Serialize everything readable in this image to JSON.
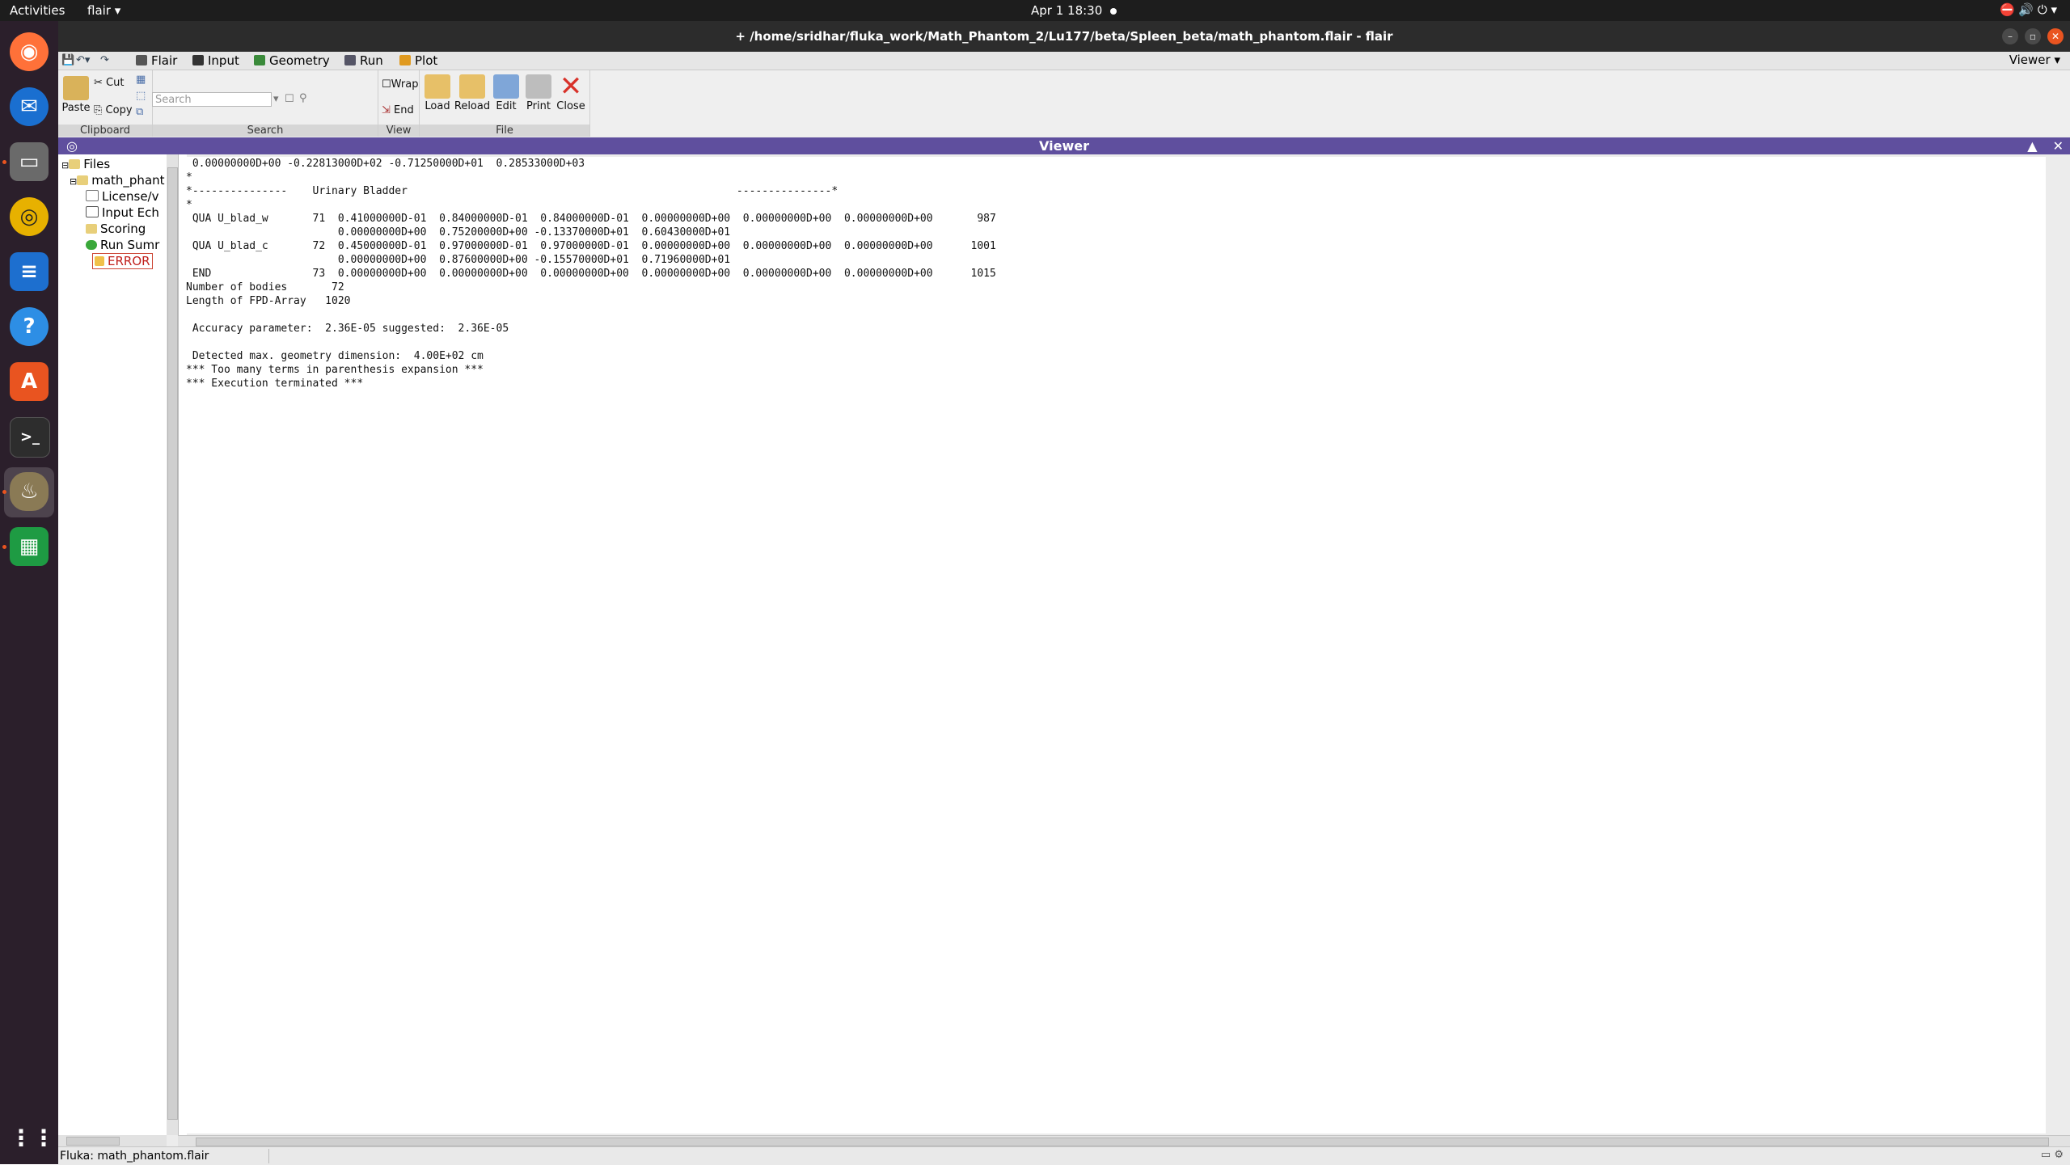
{
  "system_bar": {
    "activities": "Activities",
    "app_menu": "flair ▾",
    "clock": "Apr 1  18:30",
    "tray": "⛔   🔊  ⏻  ▾"
  },
  "window": {
    "title": "+ /home/sridhar/fluka_work/Math_Phantom_2/Lu177/beta/Spleen_beta/math_phantom.flair - flair",
    "minimize": "–",
    "maximize": "▫",
    "close": "✕"
  },
  "dock": {
    "items": [
      "Firefox",
      "Thunderbird",
      "Files",
      "Rhythmbox",
      "LibreOffice Writer",
      "Help",
      "Ubuntu Software",
      "Terminal",
      "flair",
      "LibreOffice Calc",
      "Show Applications"
    ]
  },
  "menu": {
    "tabs": [
      "Flair",
      "Input",
      "Geometry",
      "Run",
      "Plot"
    ],
    "viewer_selector": "Viewer ▾"
  },
  "ribbon": {
    "clipboard": {
      "paste": "Paste",
      "cut": "Cut",
      "copy": "Copy",
      "label": "Clipboard"
    },
    "search": {
      "placeholder": "Search",
      "label": "Search"
    },
    "view": {
      "wrap": "Wrap",
      "end": "End",
      "label": "View"
    },
    "file": {
      "load": "Load",
      "reload": "Reload",
      "edit": "Edit",
      "print": "Print",
      "close": "Close",
      "label": "File"
    }
  },
  "viewer": {
    "title": "Viewer",
    "collapse": "▲",
    "close": "✕",
    "lines": [
      " 0.00000000D+00 -0.22813000D+02 -0.71250000D+01  0.28533000D+03",
      "*",
      "*---------------    Urinary Bladder                                                    ---------------*",
      "*",
      " QUA U_blad_w       71  0.41000000D-01  0.84000000D-01  0.84000000D-01  0.00000000D+00  0.00000000D+00  0.00000000D+00       987",
      "                        0.00000000D+00  0.75200000D+00 -0.13370000D+01  0.60430000D+01",
      " QUA U_blad_c       72  0.45000000D-01  0.97000000D-01  0.97000000D-01  0.00000000D+00  0.00000000D+00  0.00000000D+00      1001",
      "                        0.00000000D+00  0.87600000D+00 -0.15570000D+01  0.71960000D+01",
      " END                73  0.00000000D+00  0.00000000D+00  0.00000000D+00  0.00000000D+00  0.00000000D+00  0.00000000D+00      1015",
      "Number of bodies       72",
      "Length of FPD-Array   1020",
      "",
      " Accuracy parameter:  2.36E-05 suggested:  2.36E-05",
      "",
      " Detected max. geometry dimension:  4.00E+02 cm",
      "*** Too many terms in parenthesis expansion ***",
      "*** Execution terminated ***"
    ]
  },
  "tree": {
    "root": "Files",
    "project": "math_phant",
    "items": [
      "License/v",
      "Input Ech",
      "Scoring",
      "Run Sumr",
      "ERROR"
    ]
  },
  "status": {
    "text": "Fluka: math_phantom.flair"
  }
}
